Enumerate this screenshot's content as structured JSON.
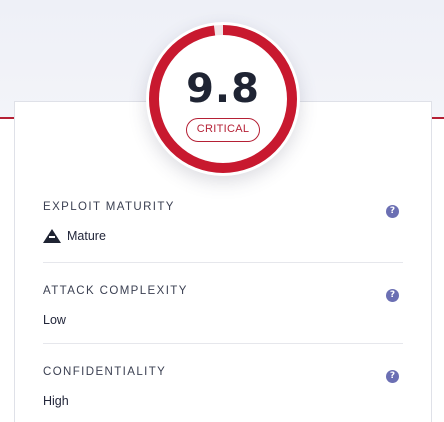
{
  "score": {
    "value": "9.8",
    "severity": "CRITICAL",
    "ring_fill_fraction": 0.98,
    "ring_color": "#c8192f"
  },
  "metrics": [
    {
      "title": "EXPLOIT MATURITY",
      "value": "Mature",
      "icon": "warning-triangle-icon",
      "help": "?"
    },
    {
      "title": "ATTACK COMPLEXITY",
      "value": "Low",
      "help": "?"
    },
    {
      "title": "CONFIDENTIALITY",
      "value": "High",
      "help": "?"
    }
  ],
  "colors": {
    "accent": "#b52035",
    "help_icon": "#6b6fb3",
    "text": "#22263a"
  }
}
